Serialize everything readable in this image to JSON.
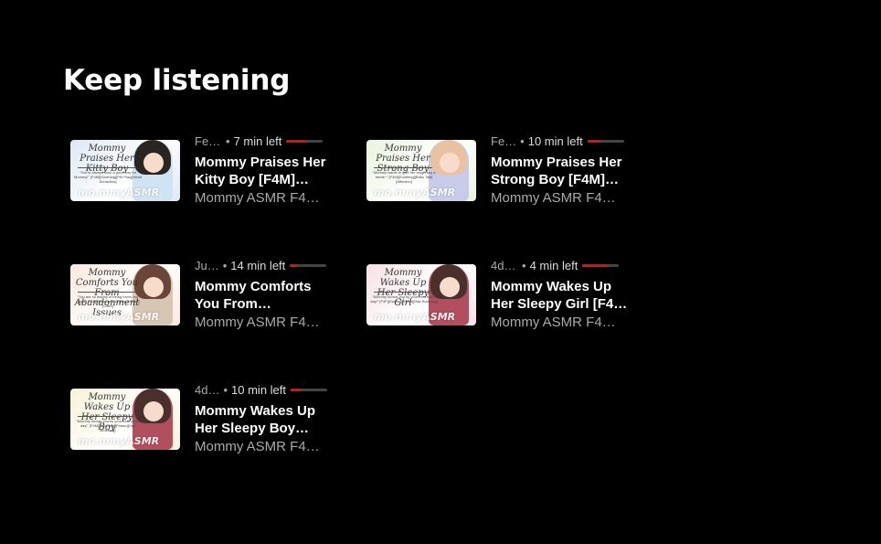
{
  "section": {
    "title": "Keep listening"
  },
  "colors": {
    "background": "#000000",
    "progress": "#e01010",
    "track": "#444444"
  },
  "items": [
    {
      "date": "Feb…",
      "time_left": "7 min left",
      "progress": 0.55,
      "title": "Mommy Praises Her Kitty Boy [F4M]…",
      "channel": "Mommy ASMR F4…",
      "thumb_title": "Mommy Praises Her Kitty Boy",
      "thumb_sub": "\"You're always such a good boy for Mommy!\" [F4M][Soothing][Pet Play][Head Scratches]",
      "thumb_brand": "mo.mmyASMR",
      "thumb_bg": "#dde8f5",
      "hair": "#2b2522",
      "dress": "#cfe3f2"
    },
    {
      "date": "Fe…",
      "time_left": "10 min left",
      "progress": 0.35,
      "title": "Mommy Praises Her Strong Boy [F4M]…",
      "channel": "Mommy ASMR F4…",
      "thumb_title": "Mommy Praises Her Strong Boy",
      "thumb_sub": "\"Mommy wants to give her tough boy a break~\" [F4M][Soothing][Baby Talk][Affection]",
      "thumb_brand": "mo.mmyASMR",
      "thumb_bg": "#e8f4dc",
      "hair": "#e9c2a2",
      "dress": "#c8cbe9"
    },
    {
      "date": "Ju…",
      "time_left": "14 min left",
      "progress": 0.2,
      "title": "Mommy Comforts You From…",
      "channel": "Mommy ASMR F4…",
      "thumb_title": "Mommy Comforts You From Abandonment Issues",
      "thumb_sub": "\"You are so worthy of being loved, my angel\" [F4A][Reassurance][Back Rubs][Calm]",
      "thumb_brand": "mo.mmyASMR",
      "thumb_bg": "#fbe8de",
      "hair": "#6a4638",
      "dress": "#d7c6b3"
    },
    {
      "date": "4d …",
      "time_left": "4 min left",
      "progress": 0.7,
      "title": "Mommy Wakes Up Her Sleepy Girl [F4…",
      "channel": "Mommy ASMR F4…",
      "thumb_title": "Mommy Wakes Up Her Sleepy Girl",
      "thumb_sub": "\"Mommy knows you by your best every day!\" [F4F][Gentle][Praise][Hair Brushing]",
      "thumb_brand": "mo.mmyASMR",
      "thumb_bg": "#f8e0e6",
      "hair": "#4a2f2c",
      "dress": "#b14f5e"
    },
    {
      "date": "4d…",
      "time_left": "10 min left",
      "progress": 0.3,
      "title": "Mommy Wakes Up Her Sleepy Boy…",
      "channel": "Mommy ASMR F4…",
      "thumb_title": "Mommy Wakes Up Her Sleepy Boy",
      "thumb_sub": "\"Mommy knows you by your best every day!\" [F4M][Soothing][Praise][Hair Brushing]",
      "thumb_brand": "mo.mmyASMR",
      "thumb_bg": "#f8f2d8",
      "hair": "#4a2f2c",
      "dress": "#b14f5e"
    }
  ]
}
